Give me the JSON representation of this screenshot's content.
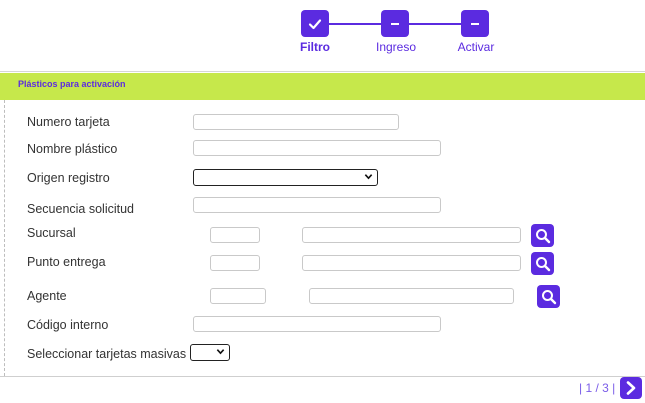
{
  "stepper": {
    "steps": [
      {
        "label": "Filtro",
        "icon": "check-icon",
        "state": "active"
      },
      {
        "label": "Ingreso",
        "icon": "minus-icon",
        "state": "pending"
      },
      {
        "label": "Activar",
        "icon": "minus-icon",
        "state": "pending"
      }
    ]
  },
  "section": {
    "title": "Plásticos para activación"
  },
  "form": {
    "numero_tarjeta": {
      "label": "Numero tarjeta",
      "value": ""
    },
    "nombre_plastico": {
      "label": "Nombre plástico",
      "value": ""
    },
    "origen_registro": {
      "label": "Origen registro",
      "selected": ""
    },
    "secuencia_solicitud": {
      "label": "Secuencia solicitud",
      "value": ""
    },
    "sucursal": {
      "label": "Sucursal",
      "code": "",
      "name": ""
    },
    "punto_entrega": {
      "label": "Punto entrega",
      "code": "",
      "name": ""
    },
    "agente": {
      "label": "Agente",
      "code": "",
      "name": ""
    },
    "codigo_interno": {
      "label": "Código interno",
      "value": ""
    },
    "seleccionar_masivas": {
      "label": "Seleccionar tarjetas masivas",
      "selected": ""
    }
  },
  "pager": {
    "text": "| 1 / 3 |"
  },
  "colors": {
    "accent": "#5b2be0",
    "section_bg": "#c6e84b"
  }
}
